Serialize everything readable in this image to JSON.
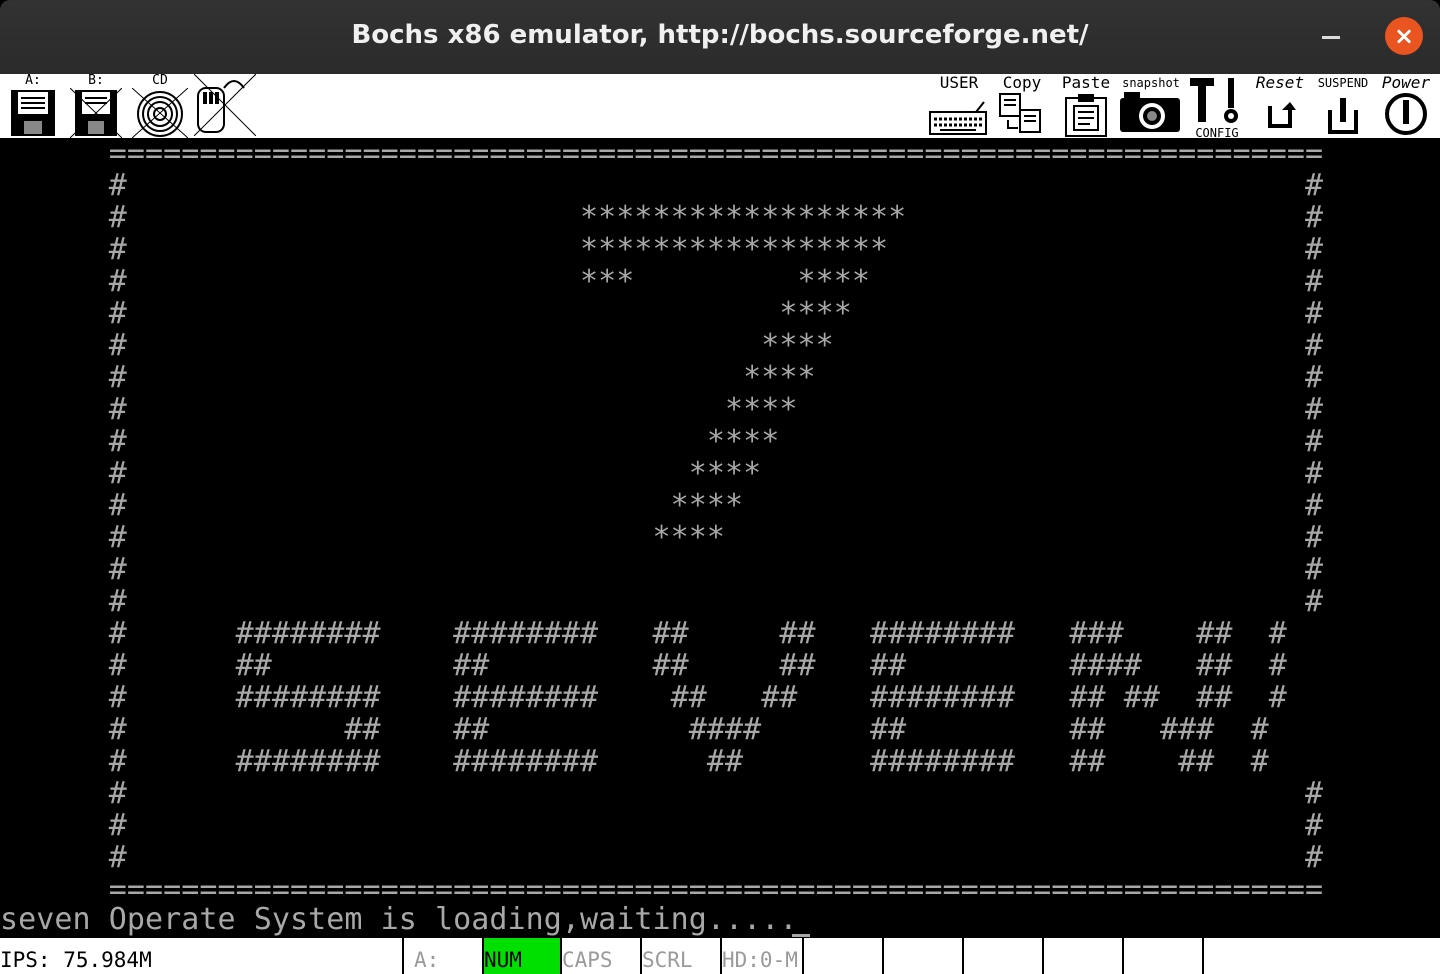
{
  "window": {
    "title": "Bochs x86 emulator, http://bochs.sourceforge.net/",
    "minimize_symbol": "–",
    "close_symbol": "×"
  },
  "toolbar": {
    "floppy_a_label": "A:",
    "floppy_b_label": "B:",
    "cdrom_label": "CD",
    "user_label": "USER",
    "copy_label": "Copy",
    "paste_label": "Paste",
    "snapshot_label": "snapshot",
    "config_label": "CONFIG",
    "reset_label": "Reset",
    "suspend_label": "SUSPEND",
    "power_label": "Power"
  },
  "console": {
    "screen_lines": [
      "      ===================================================================",
      "      #                                                                 #",
      "      #                         ******************                      #",
      "      #                         *****************                       #",
      "      #                         ***         ****                        #",
      "      #                                    ****                         #",
      "      #                                   ****                          #",
      "      #                                  ****                           #",
      "      #                                 ****                            #",
      "      #                                ****                             #",
      "      #                               ****                              #",
      "      #                              ****                               #",
      "      #                             ****                                #",
      "      #                                                                 #",
      "      #                                                                 #",
      "      #      ########    ########   ##     ##   ########   ###    ##  #",
      "      #      ##          ##         ##     ##   ##         ####   ##  #",
      "      #      ########    ########    ##   ##    ########   ## ##  ##  #",
      "      #            ##    ##           ####      ##         ##   ###  #",
      "      #      ########    ########      ##       ########   ##    ##  #",
      "      #                                                                 #",
      "      #                                                                 #",
      "      #                                                                 #",
      "      ==================================================================="
    ],
    "loading_line": "seven Operate System is loading,waiting....."
  },
  "statusbar": {
    "ips": "IPS: 75.984M",
    "drive_a": "A:",
    "num": "NUM",
    "caps": "CAPS",
    "scrl": "SCRL",
    "hd": "HD:0-M"
  },
  "colors": {
    "console_text": "#a8a8a8",
    "console_bg": "#000000",
    "num_lock_on": "#00e000",
    "titlebar_bg": "#2f2f2f",
    "close_button": "#e95420"
  }
}
